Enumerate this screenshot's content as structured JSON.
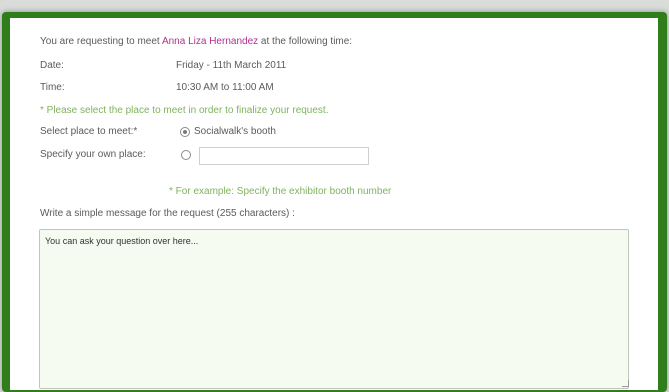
{
  "request": {
    "intro_prefix": "You are requesting to meet",
    "person_name": "Anna Liza Hernandez",
    "intro_suffix": "at the following time:"
  },
  "details": {
    "date_label": "Date:",
    "date_value": "Friday - 11th March 2011",
    "time_label": "Time:",
    "time_value": "10:30 AM to 11:00 AM"
  },
  "place": {
    "hint": "* Please select the place to meet in order to finalize your request.",
    "select_label": "Select place to meet:*",
    "option_booth_label": "Socialwalk's booth",
    "option_booth_selected": true,
    "own_label": "Specify your own place:",
    "own_value": "",
    "example_hint": "* For example: Specify the exhibitor booth number"
  },
  "message": {
    "label": "Write a simple message for the request (255 characters) :",
    "value": "You can ask your question over here..."
  },
  "colors": {
    "frame": "#2f7d1b",
    "name_highlight": "#b0308f",
    "hint_green": "#7fb35e",
    "textarea_bg": "#f5fbf1"
  }
}
